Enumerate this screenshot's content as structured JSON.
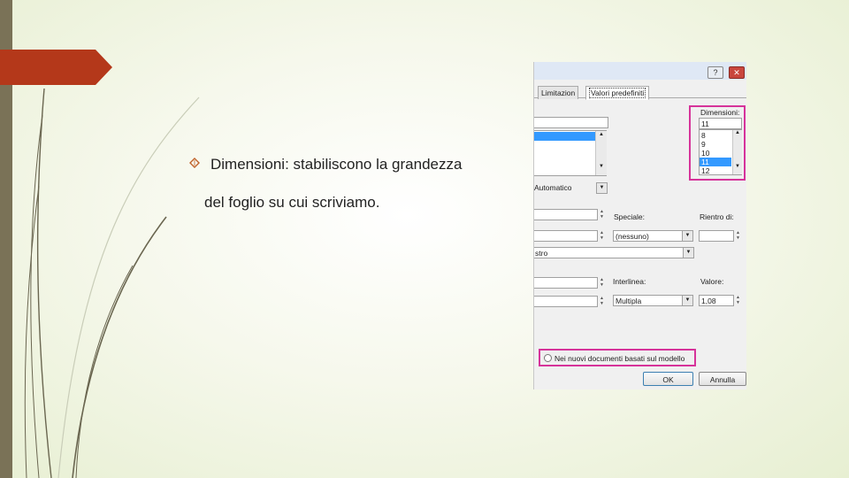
{
  "slide": {
    "line1": "Dimensioni: stabiliscono la grandezza",
    "line2": "del foglio su cui scriviamo."
  },
  "dialog": {
    "help_label": "?",
    "close_label": "✕",
    "tab_limitazioni": "Limitazion",
    "tab_valori": "Valori predefiniti",
    "font_list_selected": "",
    "dimensioni_label": "Dimensioni:",
    "dimensioni_value": "11",
    "sizes": [
      "8",
      "9",
      "10",
      "11",
      "12"
    ],
    "sizes_selected": "11",
    "automatico_value": "Automatico",
    "speciale_label": "Speciale:",
    "rientro_label": "Rientro di:",
    "speciale_value": "(nessuno)",
    "allineamento_value": "stro",
    "interlinea_label": "Interlinea:",
    "valore_label": "Valore:",
    "interlinea_value": "Multipla",
    "valore_value": "1,08",
    "radio_label": "Nei nuovi documenti basati sul modello",
    "ok_label": "OK",
    "annulla_label": "Annulla"
  },
  "colors": {
    "highlight": "#d6339a",
    "selection": "#3399ff",
    "red_tab": "#b4381a",
    "left_bar": "#7a7257"
  },
  "icons": {
    "bullet": "diamond-outline-icon",
    "dropdown": "chevron-down-icon",
    "scroll_up": "triangle-up-icon",
    "scroll_down": "triangle-down-icon"
  }
}
